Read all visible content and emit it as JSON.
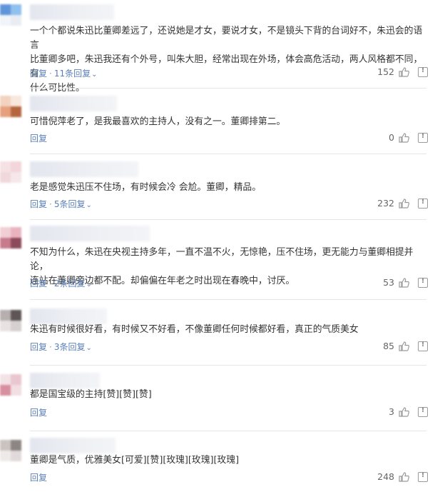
{
  "comments": [
    {
      "text": "一个个都说朱迅比董卿差远了，还说她是才女，要说才女，不是镜头下背的台词好不，朱迅会的语言\n比董卿多吧，朱迅我还有个外号，叫朱大胆，经常出现在外场，体会高危活动，两人风格都不同，有\n什么可比性。",
      "reply_label": "回复",
      "replies_label": "11条回复",
      "likes": "152",
      "avatar_colors": [
        "#5f95d9",
        "#8fc1ee",
        "#f1f4f8",
        "#e9edf2"
      ]
    },
    {
      "text": "可惜倪萍老了，是我最喜欢的主持人，没有之一。董卿排第二。",
      "reply_label": "回复",
      "replies_label": "",
      "likes": "0",
      "avatar_colors": [
        "#f2d3bf",
        "#f8e7dc",
        "#e6a07d",
        "#b5663f"
      ]
    },
    {
      "text": "老是感觉朱迅压不住场，有时候会冷 会尬。董卿，精品。",
      "reply_label": "回复",
      "replies_label": "5条回复",
      "likes": "232",
      "avatar_colors": [
        "#f6e1e4",
        "#f2d6da",
        "#f0d8dc",
        "#f6e7ea"
      ]
    },
    {
      "text": "不知为什么，朱迅在央视主持多年，一直不温不火，无惊艳，压不住场，更无能力与董卿相提并论，\n连站在董卿旁边都不配。却偏偏在年老之时出现在春晚中，讨厌。",
      "reply_label": "回复",
      "replies_label": "2条回复",
      "likes": "53",
      "avatar_colors": [
        "#f1cfd5",
        "#e9b4c0",
        "#c77b8d",
        "#8c4a5a"
      ]
    },
    {
      "text": "朱迅有时候很好看，有时候又不好看，不像董卿任何时候都好看，真正的气质美女",
      "reply_label": "回复",
      "replies_label": "3条回复",
      "likes": "85",
      "avatar_colors": [
        "#b7afae",
        "#5d5556",
        "#e8e3e3",
        "#d6d0d0"
      ]
    },
    {
      "text": "都是国宝级的主持[赞][赞][赞]",
      "reply_label": "回复",
      "replies_label": "",
      "likes": "3",
      "avatar_colors": [
        "#f3e2e6",
        "#e9c7cf",
        "#d88f9f",
        "#f1dfe3"
      ]
    },
    {
      "text": "董卿是气质，优雅美女[可爱][赞][玫瑰][玫瑰][玫瑰]",
      "reply_label": "回复",
      "replies_label": "",
      "likes": "248",
      "avatar_colors": [
        "#cbc3c0",
        "#8d8583",
        "#efeaea",
        "#e1dada"
      ]
    }
  ],
  "colors": {
    "link": "#5a7fb8",
    "text": "#333333",
    "meta": "#666666"
  }
}
